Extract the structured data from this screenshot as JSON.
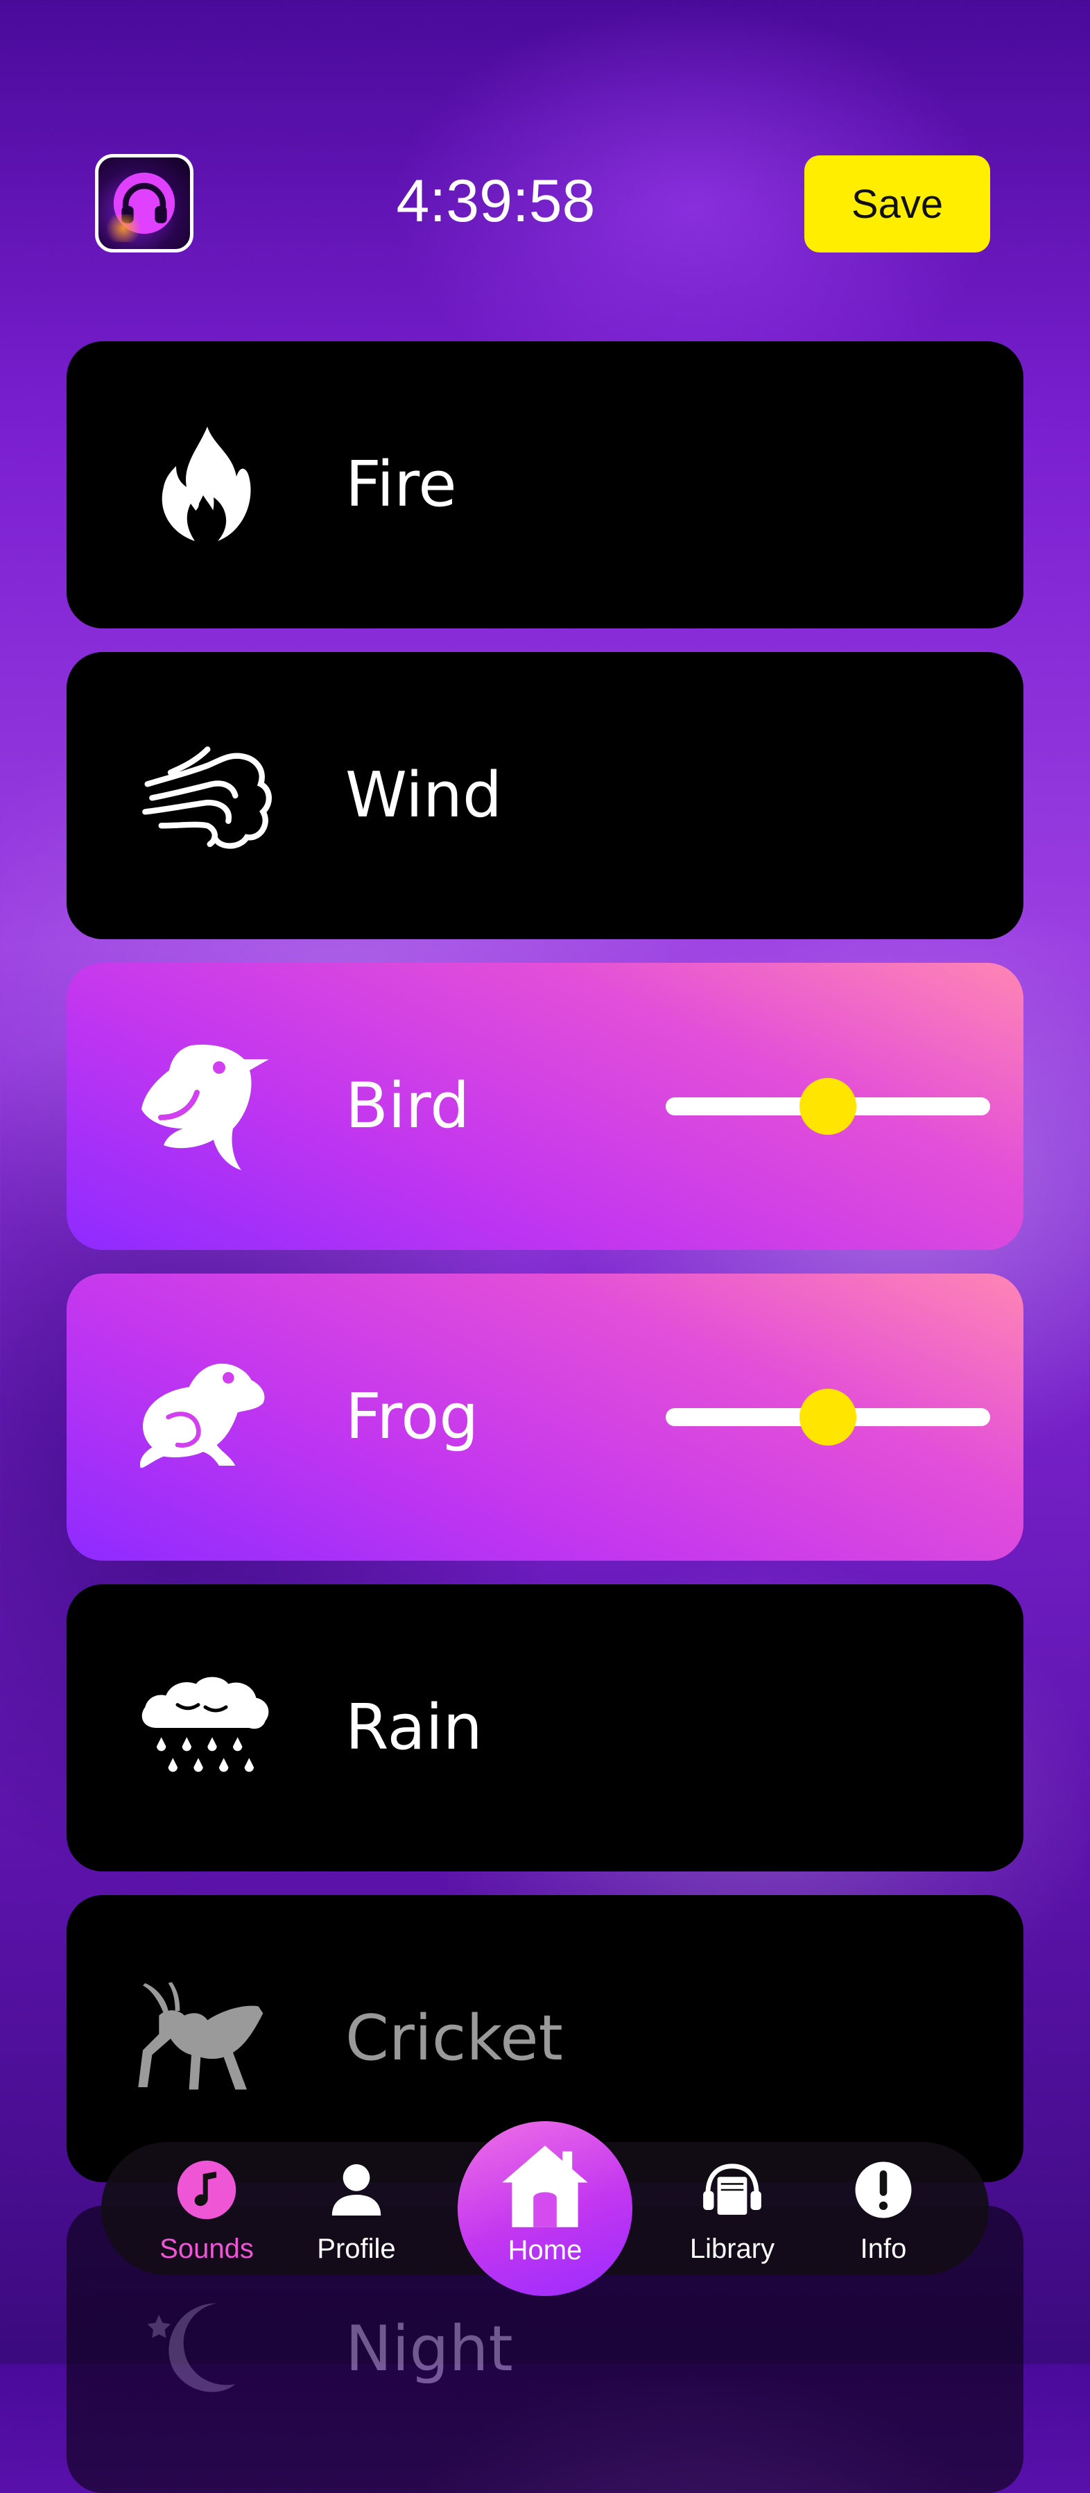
{
  "header": {
    "timer": "4:39:58",
    "save_label": "Save",
    "app_icon": "headphones-icon"
  },
  "sounds": [
    {
      "label": "Fire",
      "icon": "fire-icon",
      "active": false,
      "volume": null
    },
    {
      "label": "Wind",
      "icon": "wind-icon",
      "active": false,
      "volume": null
    },
    {
      "label": "Bird",
      "icon": "bird-icon",
      "active": true,
      "volume": 0.5
    },
    {
      "label": "Frog",
      "icon": "frog-icon",
      "active": true,
      "volume": 0.5
    },
    {
      "label": "Rain",
      "icon": "rain-cloud-icon",
      "active": false,
      "volume": null
    },
    {
      "label": "Cricket",
      "icon": "cricket-icon",
      "active": false,
      "volume": null
    },
    {
      "label": "Night",
      "icon": "moon-stars-icon",
      "active": false,
      "volume": null
    }
  ],
  "nav": {
    "sounds": "Sounds",
    "profile": "Profile",
    "home": "Home",
    "library": "Library",
    "info": "Info"
  },
  "colors": {
    "accent_yellow": "#FFEE00",
    "active_card_gradient_start": "#FF86B4",
    "active_card_gradient_end": "#8E2BFF",
    "nav_selected": "#EE56D6"
  }
}
